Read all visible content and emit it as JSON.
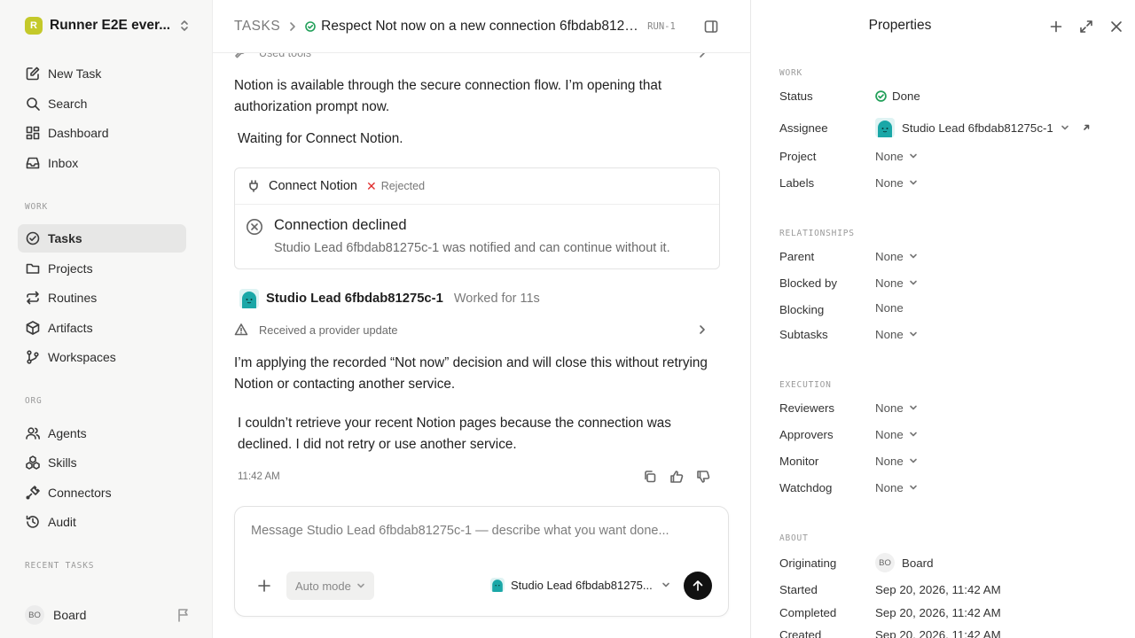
{
  "sidebar": {
    "workspace": {
      "logo_letter": "R",
      "name": "Runner E2E ever..."
    },
    "primary_nav": [
      {
        "label": "New Task",
        "icon": "pencil-square-icon"
      },
      {
        "label": "Search",
        "icon": "search-icon"
      },
      {
        "label": "Dashboard",
        "icon": "dashboard-icon"
      },
      {
        "label": "Inbox",
        "icon": "inbox-icon"
      }
    ],
    "work_label": "WORK",
    "work_nav": [
      {
        "label": "Tasks",
        "icon": "check-circle-icon",
        "active": true
      },
      {
        "label": "Projects",
        "icon": "folder-icon"
      },
      {
        "label": "Routines",
        "icon": "repeat-icon"
      },
      {
        "label": "Artifacts",
        "icon": "box-icon"
      },
      {
        "label": "Workspaces",
        "icon": "branch-icon"
      }
    ],
    "org_label": "ORG",
    "org_nav": [
      {
        "label": "Agents",
        "icon": "users-icon"
      },
      {
        "label": "Skills",
        "icon": "skills-icon"
      },
      {
        "label": "Connectors",
        "icon": "plug-icon"
      },
      {
        "label": "Audit",
        "icon": "history-icon"
      }
    ],
    "recent_label": "RECENT TASKS",
    "user": {
      "initials": "BO",
      "name": "Board"
    }
  },
  "header": {
    "root": "TASKS",
    "title": "Respect Not now on a new connection 6fbdab81275...",
    "run_id": "RUN-1",
    "status": "done"
  },
  "thread": {
    "used_tools": "Used tools",
    "para1": "Notion is available through the secure connection flow. I’m opening that authorization prompt now.",
    "waiting": "Waiting for Connect Notion.",
    "connector_card": {
      "title": "Connect Notion",
      "status": "Rejected",
      "outcome_title": "Connection declined",
      "outcome_detail": "Studio Lead 6fbdab81275c-1 was notified and can continue without it."
    },
    "agent": {
      "name": "Studio Lead 6fbdab81275c-1",
      "meta": "Worked for 11s"
    },
    "provider_update": "Received a provider update",
    "para2": "I’m applying the recorded “Not now” decision and will close this without retrying Notion or contacting another service.",
    "para3": "I couldn’t retrieve your recent Notion pages because the connection was declined. I did not retry or use another service.",
    "timestamp": "11:42 AM"
  },
  "composer": {
    "placeholder": "Message Studio Lead 6fbdab81275c-1 — describe what you want done...",
    "mode": "Auto mode",
    "agent_label": "Studio Lead 6fbdab81275..."
  },
  "properties": {
    "title": "Properties",
    "work_label": "WORK",
    "status_label": "Status",
    "status_value": "Done",
    "assignee_label": "Assignee",
    "assignee_value": "Studio Lead 6fbdab81275c-1",
    "project_label": "Project",
    "project_value": "None",
    "labels_label": "Labels",
    "labels_value": "None",
    "relationships_label": "RELATIONSHIPS",
    "parent_label": "Parent",
    "parent_value": "None",
    "blocked_by_label": "Blocked by",
    "blocked_by_value": "None",
    "blocking_label": "Blocking",
    "blocking_value": "None",
    "subtasks_label": "Subtasks",
    "subtasks_value": "None",
    "execution_label": "EXECUTION",
    "reviewers_label": "Reviewers",
    "reviewers_value": "None",
    "approvers_label": "Approvers",
    "approvers_value": "None",
    "monitor_label": "Monitor",
    "monitor_value": "None",
    "watchdog_label": "Watchdog",
    "watchdog_value": "None",
    "about_label": "ABOUT",
    "originating_label": "Originating",
    "originating_initials": "BO",
    "originating_value": "Board",
    "started_label": "Started",
    "started_value": "Sep 20, 2026, 11:42 AM",
    "completed_label": "Completed",
    "completed_value": "Sep 20, 2026, 11:42 AM",
    "created_label": "Created",
    "created_value": "Sep 20, 2026, 11:42 AM"
  },
  "colors": {
    "done_green": "#22a05a",
    "rejected_red": "#e02d2d",
    "brand_logo": "#c4c92a",
    "agent_teal": "#1aa7a7"
  }
}
